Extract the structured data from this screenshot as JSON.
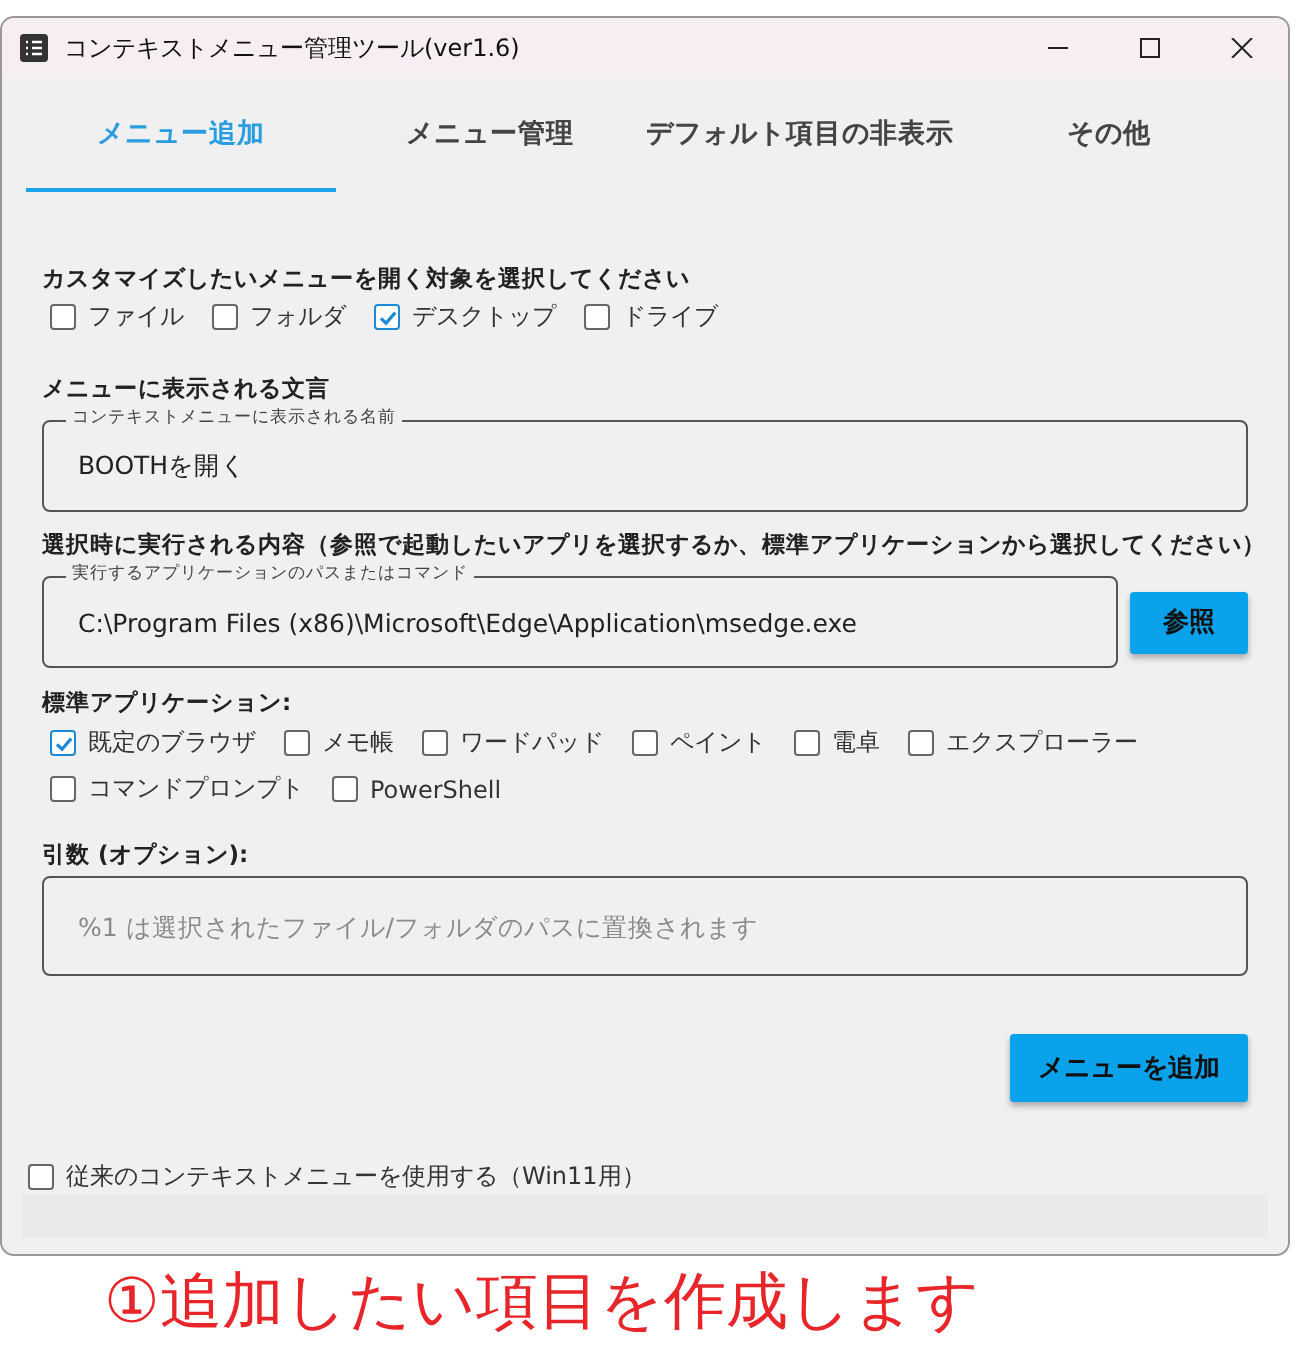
{
  "window": {
    "title": "コンテキストメニュー管理ツール(ver1.6)"
  },
  "tabs": [
    {
      "label": "メニュー追加",
      "selected": true
    },
    {
      "label": "メニュー管理",
      "selected": false
    },
    {
      "label": "デフォルト項目の非表示",
      "selected": false
    },
    {
      "label": "その他",
      "selected": false
    }
  ],
  "target": {
    "heading": "カスタマイズしたいメニューを開く対象を選択してください",
    "options": [
      {
        "label": "ファイル",
        "checked": false
      },
      {
        "label": "フォルダ",
        "checked": false
      },
      {
        "label": "デスクトップ",
        "checked": true
      },
      {
        "label": "ドライブ",
        "checked": false
      }
    ]
  },
  "menu_text": {
    "heading": "メニューに表示される文言",
    "field": {
      "label": "コンテキストメニューに表示される名前",
      "value": "BOOTHを開く"
    }
  },
  "command": {
    "heading": "選択時に実行される内容（参照で起動したいアプリを選択するか、標準アプリケーションから選択してください）",
    "field": {
      "label": "実行するアプリケーションのパスまたはコマンド",
      "value": "C:\\Program Files (x86)\\Microsoft\\Edge\\Application\\msedge.exe"
    },
    "browse_button": "参照"
  },
  "standard_apps": {
    "heading": "標準アプリケーション:",
    "options": [
      {
        "label": "既定のブラウザ",
        "checked": true
      },
      {
        "label": "メモ帳",
        "checked": false
      },
      {
        "label": "ワードパッド",
        "checked": false
      },
      {
        "label": "ペイント",
        "checked": false
      },
      {
        "label": "電卓",
        "checked": false
      },
      {
        "label": "エクスプローラー",
        "checked": false
      },
      {
        "label": "コマンドプロンプト",
        "checked": false
      },
      {
        "label": "PowerShell",
        "checked": false
      }
    ]
  },
  "arguments": {
    "heading": "引数 (オプション):",
    "field": {
      "placeholder": "%1 は選択されたファイル/フォルダのパスに置換されます"
    }
  },
  "add_button": "メニューを追加",
  "legacy_menu": {
    "label": "従来のコンテキストメニューを使用する（Win11用）",
    "checked": false
  },
  "caption": "①追加したい項目を作成します"
}
